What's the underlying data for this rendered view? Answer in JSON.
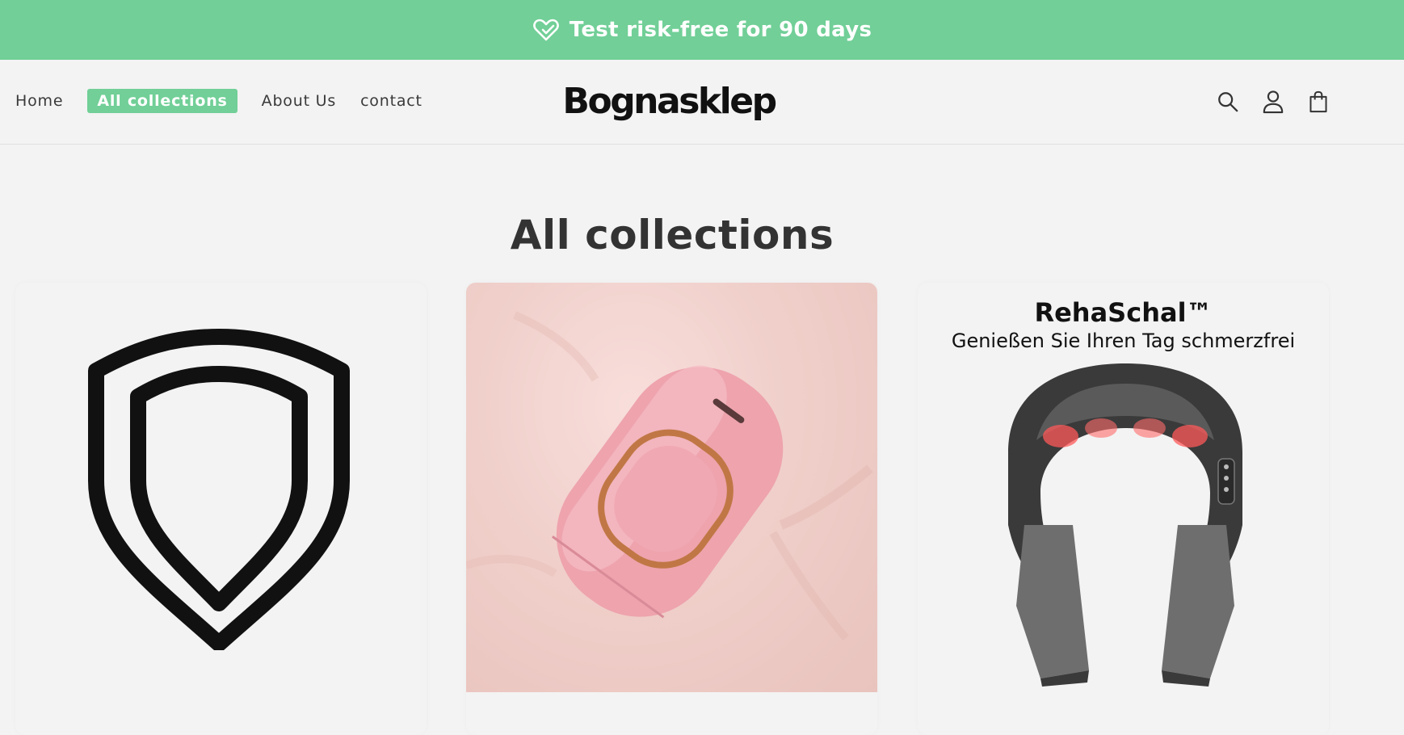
{
  "announcement": {
    "text": "Test risk-free for 90 days",
    "icon": "heart-check-icon",
    "background": "#71cf97"
  },
  "header": {
    "logo": "Bognasklep",
    "nav": [
      {
        "label": "Home",
        "active": false
      },
      {
        "label": "All collections",
        "active": true
      },
      {
        "label": "About Us",
        "active": false
      },
      {
        "label": "contact",
        "active": false
      }
    ],
    "icons": [
      "search-icon",
      "account-icon",
      "cart-icon"
    ]
  },
  "main": {
    "title": "All collections",
    "collections": [
      {
        "image": "shield-icon"
      },
      {
        "image": "pink-ipl-device-photo"
      },
      {
        "title": "RehaSchal™",
        "subtitle": "Genießen Sie Ihren Tag schmerzfrei",
        "image": "neck-massager-photo"
      }
    ]
  }
}
